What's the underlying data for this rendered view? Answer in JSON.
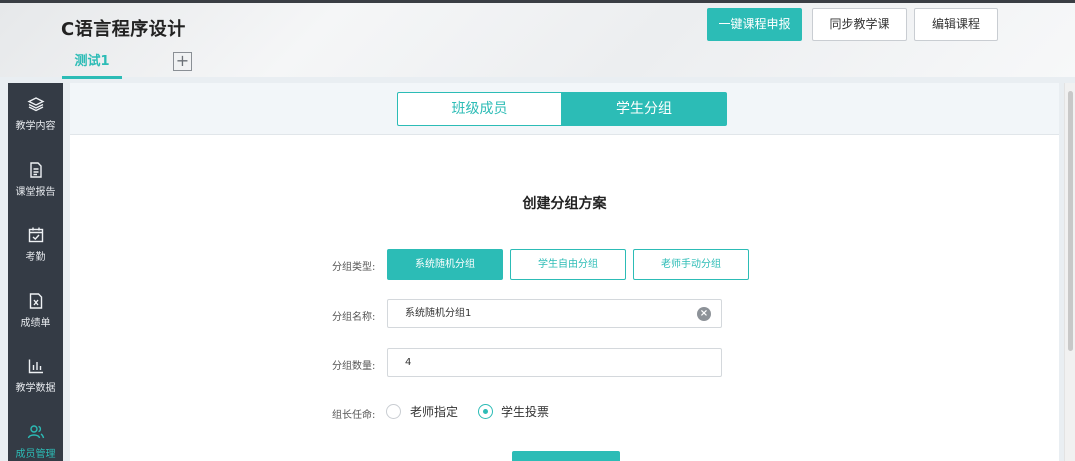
{
  "header": {
    "course_title": "C语言程序设计",
    "active_tab": "测试1",
    "add_tab_symbol": "+",
    "btn_declare": "一键课程申报",
    "btn_sync": "同步教学课",
    "btn_edit": "编辑课程"
  },
  "sidebar": {
    "items": [
      {
        "label": "教学内容",
        "icon": "layers-icon"
      },
      {
        "label": "课堂报告",
        "icon": "document-icon"
      },
      {
        "label": "考勤",
        "icon": "calendar-check-icon"
      },
      {
        "label": "成绩单",
        "icon": "grade-sheet-icon"
      },
      {
        "label": "教学数据",
        "icon": "bar-chart-icon"
      },
      {
        "label": "成员管理",
        "icon": "users-icon"
      }
    ]
  },
  "segment": {
    "left": "班级成员",
    "right": "学生分组"
  },
  "form": {
    "title": "创建分组方案",
    "type_label": "分组类型:",
    "type_options": [
      "系统随机分组",
      "学生自由分组",
      "老师手动分组"
    ],
    "name_label": "分组名称:",
    "name_value": "系统随机分组1",
    "count_label": "分组数量:",
    "count_value": "4",
    "leader_label": "组长任命:",
    "leader_options": [
      "老师指定",
      "学生投票"
    ],
    "leader_selected": "学生投票"
  },
  "colors": {
    "accent": "#2cbcb6",
    "sidebar_bg": "#343b45"
  }
}
